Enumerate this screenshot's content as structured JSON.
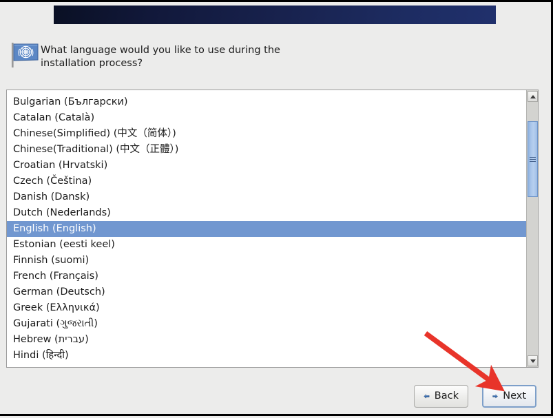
{
  "banner": {
    "gradient_start": "#0a1024",
    "gradient_end": "#20306c"
  },
  "header": {
    "icon": "flag-icon",
    "question": "What language would you like to use during the\ninstallation process?"
  },
  "language_list": {
    "selected": "English (English)",
    "items": [
      {
        "label": "Bulgarian (Български)",
        "selected": false
      },
      {
        "label": "Catalan (Català)",
        "selected": false
      },
      {
        "label": "Chinese(Simplified) (中文（简体）)",
        "selected": false
      },
      {
        "label": "Chinese(Traditional) (中文（正體）)",
        "selected": false
      },
      {
        "label": "Croatian (Hrvatski)",
        "selected": false
      },
      {
        "label": "Czech (Čeština)",
        "selected": false
      },
      {
        "label": "Danish (Dansk)",
        "selected": false
      },
      {
        "label": "Dutch (Nederlands)",
        "selected": false
      },
      {
        "label": "English (English)",
        "selected": true
      },
      {
        "label": "Estonian (eesti keel)",
        "selected": false
      },
      {
        "label": "Finnish (suomi)",
        "selected": false
      },
      {
        "label": "French (Français)",
        "selected": false
      },
      {
        "label": "German (Deutsch)",
        "selected": false
      },
      {
        "label": "Greek (Ελληνικά)",
        "selected": false
      },
      {
        "label": "Gujarati (ગુજરાતી)",
        "selected": false
      },
      {
        "label": "Hebrew (עברית)",
        "selected": false
      },
      {
        "label": "Hindi (हिन्दी)",
        "selected": false
      }
    ],
    "selection_color": "#7197d0"
  },
  "scrollbar": {
    "up_arrow": "chevron-up-icon",
    "down_arrow": "chevron-down-icon",
    "thumb_color": "#a9c5ea"
  },
  "buttons": {
    "back": {
      "label": "Back",
      "icon": "arrow-left-icon",
      "focused": false
    },
    "next": {
      "label": "Next",
      "icon": "arrow-right-icon",
      "focused": true
    }
  },
  "annotation": {
    "color": "#e8342a",
    "points_to": "next-button"
  }
}
